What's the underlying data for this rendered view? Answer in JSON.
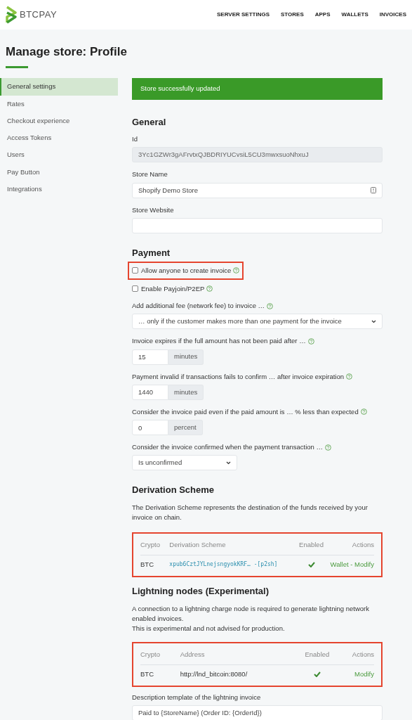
{
  "brand": "BTCPAY",
  "nav": [
    {
      "label": "SERVER SETTINGS"
    },
    {
      "label": "STORES"
    },
    {
      "label": "APPS"
    },
    {
      "label": "WALLETS"
    },
    {
      "label": "INVOICES"
    }
  ],
  "page_title": "Manage store: Profile",
  "sidebar": [
    {
      "label": "General settings",
      "selected": true
    },
    {
      "label": "Rates",
      "selected": false
    },
    {
      "label": "Checkout experience",
      "selected": false
    },
    {
      "label": "Access Tokens",
      "selected": false
    },
    {
      "label": "Users",
      "selected": false
    },
    {
      "label": "Pay Button",
      "selected": false
    },
    {
      "label": "Integrations",
      "selected": false
    }
  ],
  "alert": "Store successfully updated",
  "general": {
    "heading": "General",
    "fields": [
      {
        "kind": "readonly",
        "label": "Id",
        "value": "3Yc1GZWr3gAFrvtxQJBDRIYUCvsiL5CU3mwxsuoNhxuJ"
      },
      {
        "kind": "text",
        "label": "Store Name",
        "value": "Shopify Demo Store",
        "key_icon": true
      },
      {
        "kind": "text",
        "label": "Store Website"
      }
    ]
  },
  "payment": {
    "heading": "Payment",
    "items": [
      {
        "kind": "checkbox",
        "label": "Allow anyone to create invoice",
        "checked": false,
        "highlighted": true
      },
      {
        "kind": "checkbox",
        "label": "Enable Payjoin/P2EP",
        "checked": false
      },
      {
        "kind": "select",
        "label": "Add additional fee (network fee) to invoice …",
        "value": "… only if the customer makes more than one payment for the invoice",
        "wide": true
      },
      {
        "kind": "addon",
        "label": "Invoice expires if the full amount has not been paid after …",
        "value": "15",
        "addon": "minutes"
      },
      {
        "kind": "addon",
        "label": "Payment invalid if transactions fails to confirm … after invoice expiration",
        "value": "1440",
        "addon": "minutes"
      },
      {
        "kind": "addon",
        "label": "Consider the invoice paid even if the paid amount is … % less than expected",
        "value": "0",
        "addon": "percent"
      },
      {
        "kind": "select",
        "label": "Consider the invoice confirmed when the payment transaction …",
        "value": "Is unconfirmed",
        "wide": false
      }
    ]
  },
  "derivation": {
    "heading": "Derivation Scheme",
    "description": "The Derivation Scheme represents the destination of the funds received by your invoice on chain.",
    "highlighted": true,
    "columns": [
      "Crypto",
      "Derivation Scheme",
      "Enabled",
      "Actions"
    ],
    "rows": [
      {
        "crypto": "BTC",
        "value": "xpub6CztJYLnejsngyokKRF… -[p2sh]",
        "enabled": true,
        "actions": [
          "Wallet",
          "Modify"
        ],
        "action_separator": "-"
      }
    ]
  },
  "lightning": {
    "heading": "Lightning nodes (Experimental)",
    "description": [
      "A connection to a lightning charge node is required to generate lightning network enabled invoices.",
      "This is experimental and not advised for production."
    ],
    "highlighted": true,
    "columns": [
      "Crypto",
      "Address",
      "Enabled",
      "Actions"
    ],
    "rows": [
      {
        "crypto": "BTC",
        "value": "http://lnd_bitcoin:8080/",
        "enabled": true,
        "actions": [
          "Modify"
        ]
      }
    ],
    "template_label": "Description template of the lightning invoice",
    "template_value": "Paid to {StoreName} (Order ID: {OrderId})"
  }
}
